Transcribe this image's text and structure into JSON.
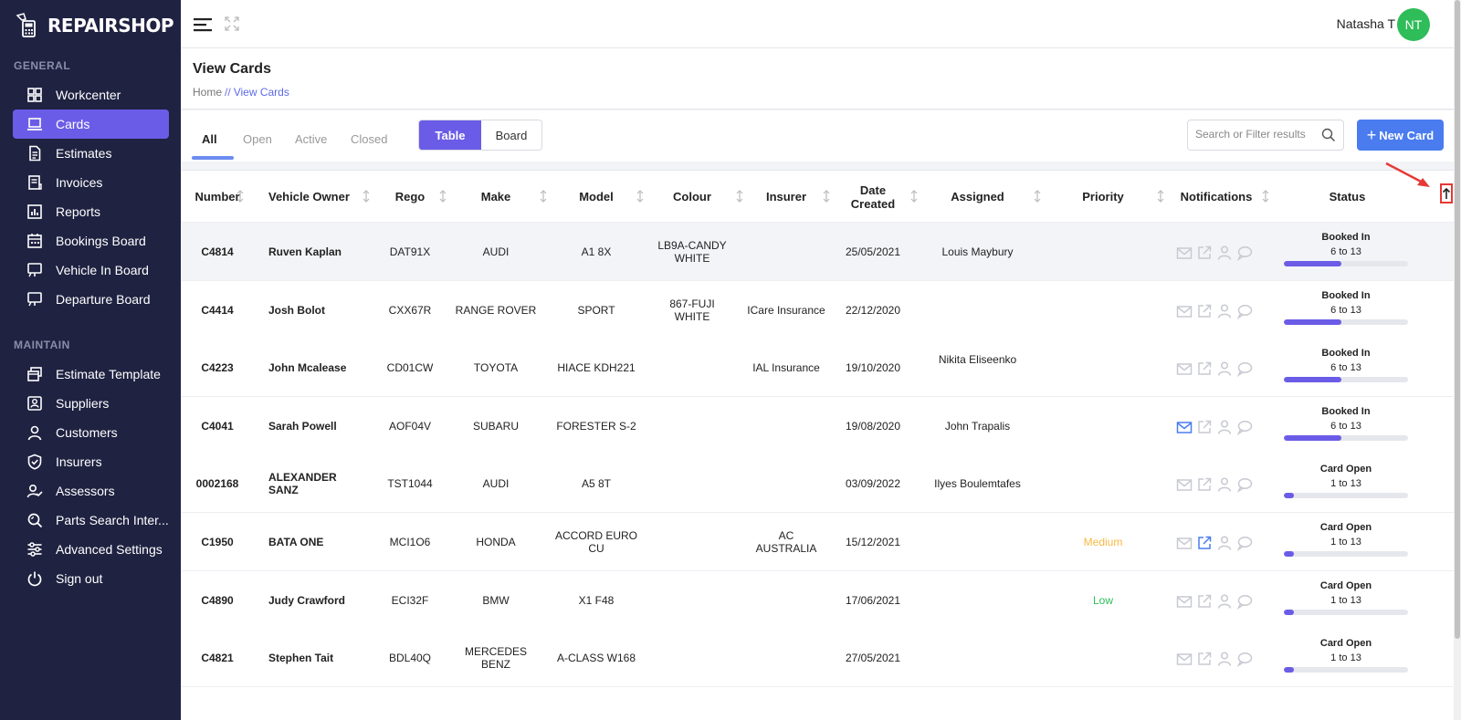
{
  "app": {
    "name": "REPAIRSHOP"
  },
  "sidebar": {
    "sections": [
      {
        "title": "GENERAL"
      },
      {
        "title": "MAINTAIN"
      }
    ],
    "general": [
      {
        "label": "Workcenter",
        "icon": "grid-icon"
      },
      {
        "label": "Cards",
        "icon": "laptop-icon",
        "active": true
      },
      {
        "label": "Estimates",
        "icon": "document-icon"
      },
      {
        "label": "Invoices",
        "icon": "invoice-icon"
      },
      {
        "label": "Reports",
        "icon": "bar-chart-icon"
      },
      {
        "label": "Bookings Board",
        "icon": "calendar-icon"
      },
      {
        "label": "Vehicle In Board",
        "icon": "monitor-icon"
      },
      {
        "label": "Departure Board",
        "icon": "monitor-icon"
      }
    ],
    "maintain": [
      {
        "label": "Estimate Template",
        "icon": "windows-icon"
      },
      {
        "label": "Suppliers",
        "icon": "contact-card-icon"
      },
      {
        "label": "Customers",
        "icon": "user-icon"
      },
      {
        "label": "Insurers",
        "icon": "shield-icon"
      },
      {
        "label": "Assessors",
        "icon": "user-check-icon"
      },
      {
        "label": "Parts Search Inter...",
        "icon": "search-icon"
      },
      {
        "label": "Advanced Settings",
        "icon": "sliders-icon"
      },
      {
        "label": "Sign out",
        "icon": "power-icon"
      }
    ]
  },
  "topbar": {
    "user_name": "Natasha T",
    "avatar_initials": "NT",
    "avatar_color": "#2ebd59"
  },
  "page": {
    "title": "View Cards",
    "breadcrumb": {
      "home": "Home",
      "separator": "//",
      "current": "View Cards"
    }
  },
  "toolbar": {
    "tabs": [
      "All",
      "Open",
      "Active",
      "Closed"
    ],
    "active_tab": "All",
    "view_toggle": [
      "Table",
      "Board"
    ],
    "active_view": "Table",
    "search_placeholder": "Search or Filter results",
    "new_card_label": "New Card"
  },
  "table": {
    "columns": [
      "Number",
      "Vehicle Owner",
      "Rego",
      "Make",
      "Model",
      "Colour",
      "Insurer",
      "Date Created",
      "Assigned",
      "Priority",
      "Notifications",
      "Status"
    ],
    "rows": [
      {
        "number": "C4814",
        "owner": "Ruven Kaplan",
        "rego": "DAT91X",
        "make": "AUDI",
        "model": "A1 8X",
        "colour": "LB9A-CANDY WHITE",
        "insurer": "",
        "date": "25/05/2021",
        "assigned": "Louis Maybury",
        "priority": "",
        "status": "Booked In",
        "range": "6 to 13",
        "progress": 0.46,
        "mail_active": false,
        "link_active": false
      },
      {
        "number": "C4414",
        "owner": "Josh Bolot",
        "rego": "CXX67R",
        "make": "RANGE ROVER",
        "model": "SPORT",
        "colour": "867-FUJI WHITE",
        "insurer": "ICare Insurance",
        "date": "22/12/2020",
        "assigned": "",
        "priority": "",
        "status": "Booked In",
        "range": "6 to 13",
        "progress": 0.46,
        "mail_active": false,
        "link_active": false
      },
      {
        "number": "C4223",
        "owner": "John Mcalease",
        "rego": "CD01CW",
        "make": "TOYOTA",
        "model": "HIACE KDH221",
        "colour": "",
        "insurer": "IAL Insurance",
        "date": "19/10/2020",
        "assigned": "Nikita Eliseenko",
        "priority": "",
        "status": "Booked In",
        "range": "6 to 13",
        "progress": 0.46,
        "mail_active": false,
        "link_active": false
      },
      {
        "number": "C4041",
        "owner": "Sarah Powell",
        "rego": "AOF04V",
        "make": "SUBARU",
        "model": "FORESTER S-2",
        "colour": "",
        "insurer": "",
        "date": "19/08/2020",
        "assigned": "John Trapalis",
        "priority": "",
        "status": "Booked In",
        "range": "6 to 13",
        "progress": 0.46,
        "mail_active": true,
        "link_active": false
      },
      {
        "number": "0002168",
        "owner": "ALEXANDER SANZ",
        "rego": "TST1044",
        "make": "AUDI",
        "model": "A5 8T",
        "colour": "",
        "insurer": "",
        "date": "03/09/2022",
        "assigned": "Ilyes Boulemtafes",
        "priority": "",
        "status": "Card Open",
        "range": "1 to 13",
        "progress": 0.08,
        "mail_active": false,
        "link_active": false
      },
      {
        "number": "C1950",
        "owner": "BATA ONE",
        "rego": "MCI1O6",
        "make": "HONDA",
        "model": "ACCORD EURO CU",
        "colour": "",
        "insurer": "AC AUSTRALIA",
        "date": "15/12/2021",
        "assigned": "",
        "priority": "Medium",
        "status": "Card Open",
        "range": "1 to 13",
        "progress": 0.08,
        "mail_active": false,
        "link_active": true
      },
      {
        "number": "C4890",
        "owner": "Judy Crawford",
        "rego": "ECI32F",
        "make": "BMW",
        "model": "X1 F48",
        "colour": "",
        "insurer": "",
        "date": "17/06/2021",
        "assigned": "",
        "priority": "Low",
        "status": "Card Open",
        "range": "1 to 13",
        "progress": 0.08,
        "mail_active": false,
        "link_active": false
      },
      {
        "number": "C4821",
        "owner": "Stephen Tait",
        "rego": "BDL40Q",
        "make": "MERCEDES BENZ",
        "model": "A-CLASS W168",
        "colour": "",
        "insurer": "",
        "date": "27/05/2021",
        "assigned": "",
        "priority": "",
        "status": "Card Open",
        "range": "1 to 13",
        "progress": 0.08,
        "mail_active": false,
        "link_active": false
      }
    ]
  },
  "colors": {
    "accent": "#6b5ce7",
    "sidebar_bg": "#1f2241",
    "primary_button": "#4a7cf0",
    "priority_medium": "#f5b942",
    "priority_low": "#2ebd59",
    "icon_active": "#4a7cf0",
    "icon_inactive": "#c8cad2"
  }
}
